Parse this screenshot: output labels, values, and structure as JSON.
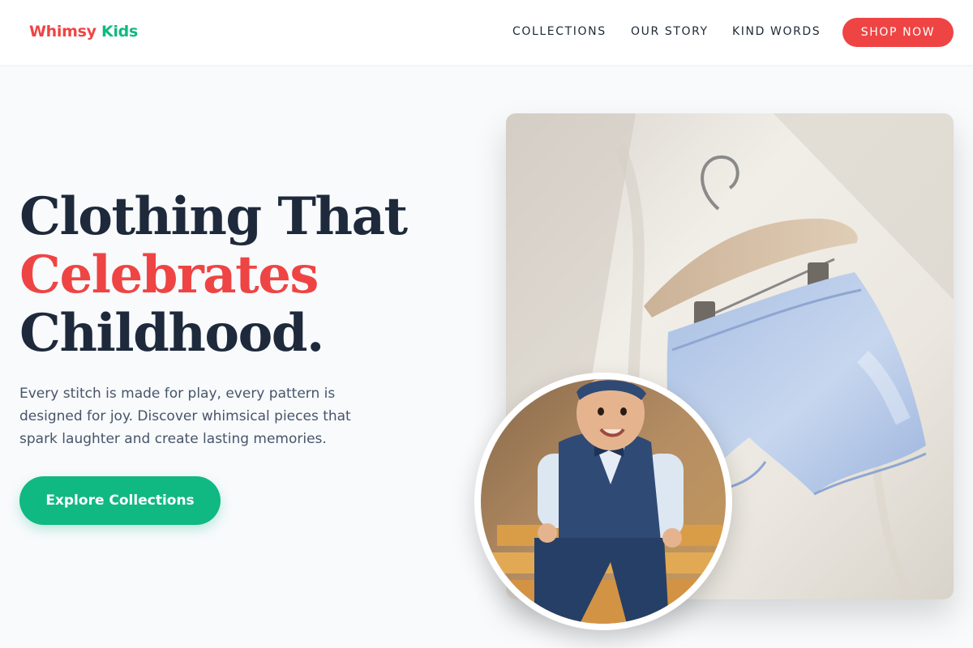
{
  "brand": {
    "first": "Whimsy",
    "second": "Kids"
  },
  "nav": {
    "items": [
      {
        "label": "COLLECTIONS"
      },
      {
        "label": "OUR STORY"
      },
      {
        "label": "KIND WORDS"
      }
    ],
    "cta": "SHOP NOW"
  },
  "hero": {
    "line1": "Clothing That",
    "line2": "Celebrates",
    "line3": "Childhood.",
    "subtitle": "Every stitch is made for play, every pattern is designed for joy. Discover whimsical pieces that spark laughter and create lasting memories.",
    "button": "Explore Collections"
  },
  "colors": {
    "accent_red": "#ef4444",
    "accent_green": "#10b981",
    "heading": "#1e293b",
    "body_text": "#475569",
    "background": "#f8fafc"
  }
}
